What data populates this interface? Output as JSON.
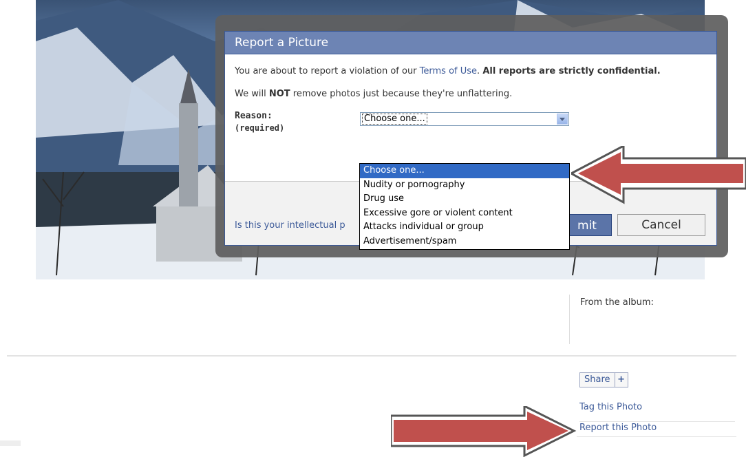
{
  "dialog": {
    "title": "Report a Picture",
    "intro_pre": "You are about to report a violation of our ",
    "intro_link": "Terms of Use",
    "intro_mid": ". ",
    "intro_bold": "All reports are strictly confidential.",
    "notice_pre": "We will ",
    "notice_bold": "NOT",
    "notice_post": " remove photos just because they're unflattering.",
    "reason_label": "Reason:",
    "reason_required": "(required)",
    "reason_value": "Choose one...",
    "footer_link": "Is this your intellectual p",
    "submit_label": "mit",
    "cancel_label": "Cancel"
  },
  "dropdown": {
    "options": [
      "Choose one...",
      "Nudity or pornography",
      "Drug use",
      "Excessive gore or violent content",
      "Attacks individual or group",
      "Advertisement/spam"
    ],
    "selected_index": 0
  },
  "sidebar": {
    "album_label": "From the album:",
    "share_label": "Share",
    "share_plus": "+",
    "tag_link": "Tag this Photo",
    "report_link": "Report this Photo"
  },
  "colors": {
    "dialog_header": "#6d84b4",
    "link": "#3b5998",
    "arrow": "#c0504d",
    "selection": "#316ac5"
  },
  "icons": {
    "select_dropdown": "chevron-down-icon",
    "share_add": "plus-icon",
    "annotation": "arrow-left-icon"
  }
}
